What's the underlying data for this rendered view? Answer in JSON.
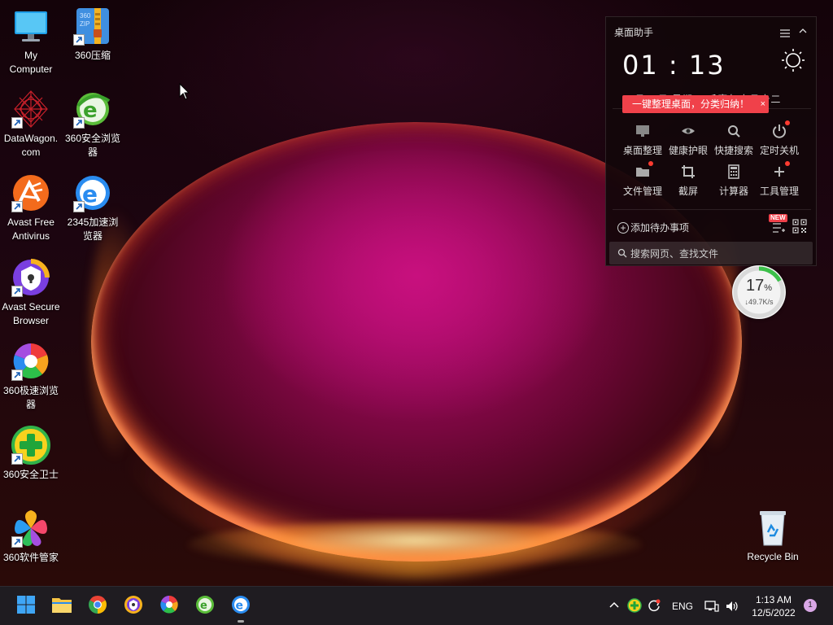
{
  "desktop": {
    "icons": [
      {
        "label": "My\nComputer"
      },
      {
        "label": "360压缩"
      },
      {
        "label": "DataWagon.\ncom"
      },
      {
        "label": "360安全浏览\n器"
      },
      {
        "label": "Avast Free\nAntivirus"
      },
      {
        "label": "2345加速浏\n览器"
      },
      {
        "label": "Avast Secure\nBrowser"
      },
      {
        "label": "360极速浏览\n器"
      },
      {
        "label": "360安全卫士"
      },
      {
        "label": "360软件管家"
      }
    ],
    "recycle_bin": {
      "label": "Recycle Bin"
    }
  },
  "widget": {
    "title": "桌面助手",
    "time": "01 : 13",
    "date": "12月05日  星期一  壬寅年十月十二",
    "tip": "一键整理桌面，分类归纳！",
    "tip_close": "×",
    "tools": [
      {
        "label": "桌面整理",
        "icon": "monitor-icon",
        "dot": false
      },
      {
        "label": "健康护眼",
        "icon": "eye-icon",
        "dot": false
      },
      {
        "label": "快捷搜索",
        "icon": "search-icon",
        "dot": false
      },
      {
        "label": "定时关机",
        "icon": "power-icon",
        "dot": true
      },
      {
        "label": "文件管理",
        "icon": "folder-icon",
        "dot": true
      },
      {
        "label": "截屏",
        "icon": "crop-icon",
        "dot": false
      },
      {
        "label": "计算器",
        "icon": "calculator-icon",
        "dot": false
      },
      {
        "label": "工具管理",
        "icon": "plus-icon",
        "dot": true
      }
    ],
    "todo_label": "添加待办事项",
    "new_badge": "NEW",
    "search_placeholder": "搜索网页、查找文件"
  },
  "speedball": {
    "percent": "17",
    "percent_unit": "%",
    "percent_value": 0.17,
    "speed": "↓49.7K/s"
  },
  "taskbar": {
    "apps": [
      "start-icon",
      "file-explorer-icon",
      "chrome-icon",
      "avast-secure-browser-icon",
      "360-speed-browser-icon",
      "360-safe-browser-icon",
      "ie-2345-browser-icon"
    ],
    "tray": {
      "lang": "ENG"
    },
    "clock": {
      "time": "1:13 AM",
      "date": "12/5/2022"
    },
    "notifications": "1"
  },
  "colors": {
    "tip_red": "#f0414a",
    "speed_green": "#3cc04a",
    "accent_blue": "#2a8cf0"
  }
}
